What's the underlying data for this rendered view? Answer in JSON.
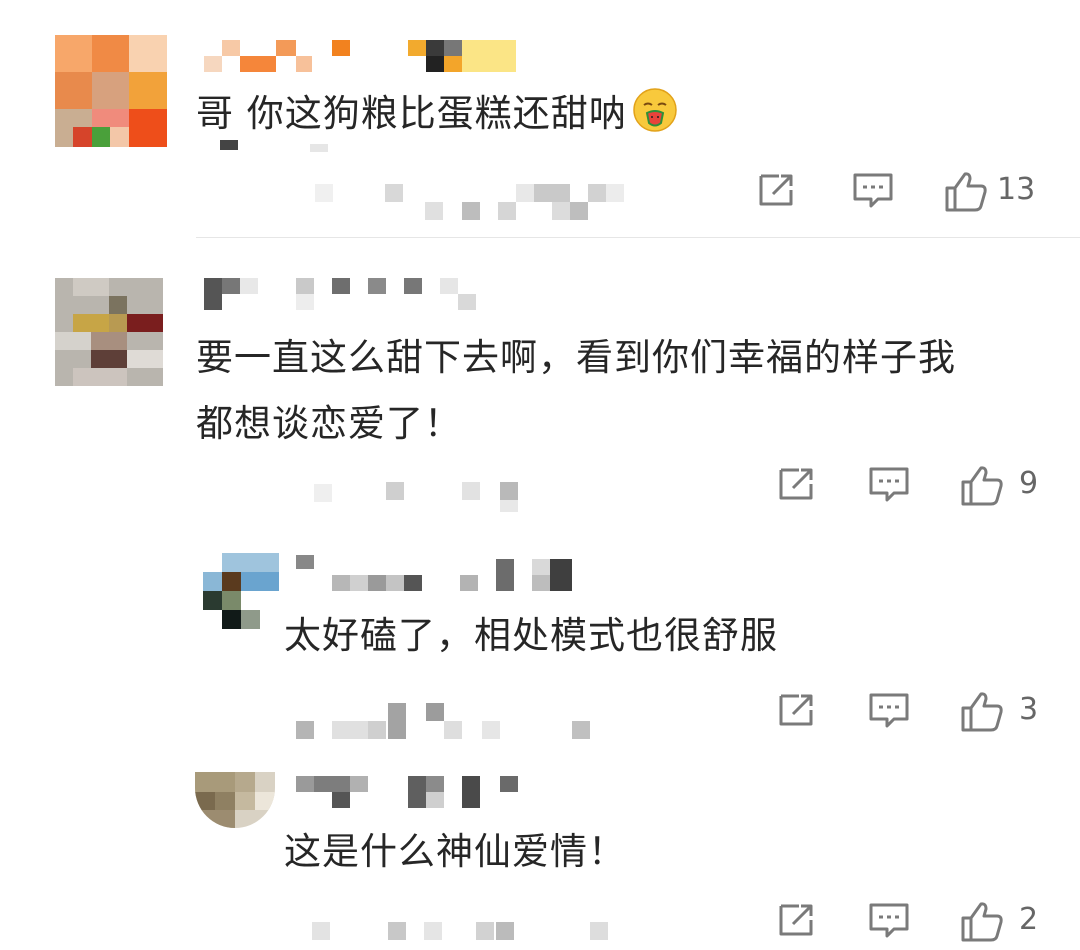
{
  "comments": [
    {
      "text": "哥 你这狗粮比蛋糕还甜呐",
      "emoji": "smiling-face-with-watermelon-emoji",
      "likes": "13"
    },
    {
      "text_line1": "要一直这么甜下去啊，看到你们幸福的样子我",
      "text_line2": "都想谈恋爱了！",
      "likes": "9"
    },
    {
      "text": "太好磕了，相处模式也很舒服",
      "likes": "3"
    },
    {
      "text": "这是什么神仙爱情！",
      "likes": "2"
    }
  ],
  "icons": {
    "share": "share-icon",
    "reply": "comment-icon",
    "like": "thumbs-up-icon"
  },
  "colors": {
    "text": "#262626",
    "icon": "#777777",
    "divider": "#e6e6e6"
  }
}
